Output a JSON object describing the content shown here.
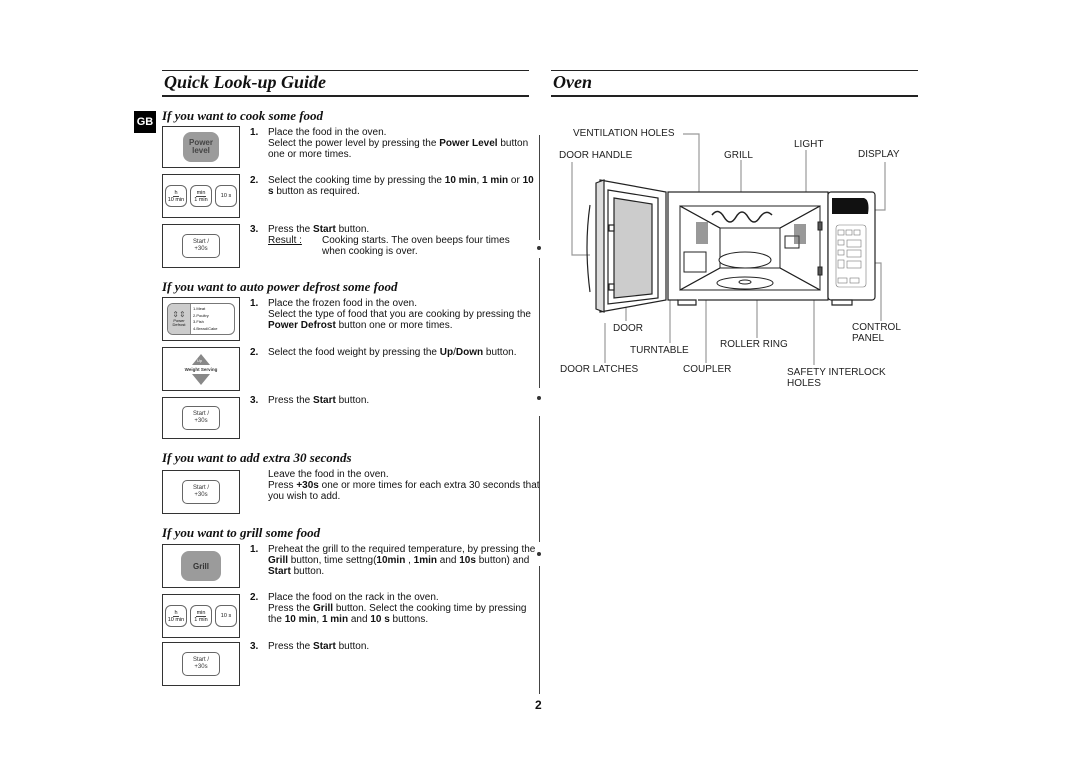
{
  "left": {
    "title": "Quick Look-up Guide",
    "lang_tab": "GB",
    "sections": [
      {
        "heading": "If you want to cook some food",
        "panels": [
          {
            "type": "power-level",
            "label_line1": "Power",
            "label_line2": "level"
          },
          {
            "type": "time-buttons",
            "buttons": [
              {
                "top": "h",
                "bottom": "10 min"
              },
              {
                "top": "min",
                "bottom": "1 min"
              },
              {
                "single": "10 s"
              }
            ]
          },
          {
            "type": "start",
            "line1": "Start /",
            "line2": "+30s"
          }
        ],
        "steps": [
          {
            "num": "1.",
            "parts": [
              "Place the food in the oven.",
              "Select the power level by pressing the ",
              "Power Level",
              " button one or more times."
            ]
          },
          {
            "num": "2.",
            "parts": [
              "Select the cooking time by pressing the ",
              "10 min",
              ", ",
              "1 min",
              " or ",
              "10 s",
              " button as required."
            ]
          },
          {
            "num": "3.",
            "parts": [
              "Press the ",
              "Start",
              " button."
            ],
            "result_label": "Result :",
            "result_text": "Cooking starts. The oven beeps four times when cooking is over."
          }
        ]
      },
      {
        "heading": "If you want to auto power defrost some food",
        "panels": [
          {
            "type": "defrost",
            "arrows": "⇕⇕",
            "label_line1": "Power",
            "label_line2": "Defrost",
            "options": [
              "1.Meat",
              "2.Poultry",
              "3.Fish",
              "4.Bread/Cake"
            ]
          },
          {
            "type": "up-down",
            "up": "Up",
            "middle": "Weight Serving",
            "down": "Down"
          },
          {
            "type": "start",
            "line1": "Start /",
            "line2": "+30s"
          }
        ],
        "steps": [
          {
            "num": "1.",
            "parts": [
              "Place the frozen food in the oven.",
              "Select the type of food that you are cooking by pressing the ",
              "Power Defrost",
              " button one or more times."
            ]
          },
          {
            "num": "2.",
            "parts": [
              "Select the food weight by pressing the ",
              "Up",
              "/",
              "Down",
              " button."
            ]
          },
          {
            "num": "3.",
            "parts": [
              "Press the ",
              "Start",
              " button."
            ]
          }
        ]
      },
      {
        "heading": "If you want to add extra 30 seconds",
        "panels": [
          {
            "type": "start",
            "line1": "Start /",
            "line2": "+30s"
          }
        ],
        "steps": [
          {
            "num": "",
            "parts": [
              "Leave the food in the oven.",
              "Press ",
              "+30s",
              " one or more times for each extra 30 seconds that you wish to add."
            ]
          }
        ]
      },
      {
        "heading": "If you want to grill some food",
        "panels": [
          {
            "type": "grill",
            "label": "Grill"
          },
          {
            "type": "time-buttons",
            "buttons": [
              {
                "top": "h",
                "bottom": "10 min"
              },
              {
                "top": "min",
                "bottom": "1 min"
              },
              {
                "single": "10 s"
              }
            ]
          },
          {
            "type": "start",
            "line1": "Start /",
            "line2": "+30s"
          }
        ],
        "steps": [
          {
            "num": "1.",
            "parts": [
              "Preheat the grill to the required temperature, by pressing the ",
              "Grill",
              " button, time settng(",
              "10min",
              " , ",
              "1min",
              " and ",
              "10s",
              " button) and ",
              "Start",
              " button."
            ]
          },
          {
            "num": "2.",
            "parts": [
              "Place the food on the rack in the oven.",
              "Press the ",
              "Grill",
              " button. Select the cooking time by pressing the ",
              "10 min",
              ", ",
              "1 min",
              " and ",
              "10 s",
              " buttons."
            ]
          },
          {
            "num": "3.",
            "parts": [
              "Press the ",
              "Start",
              " button."
            ]
          }
        ]
      }
    ]
  },
  "right": {
    "title": "Oven",
    "labels": {
      "ventilation_holes": "VENTILATION HOLES",
      "door_handle": "DOOR HANDLE",
      "grill": "GRILL",
      "light": "LIGHT",
      "display": "DISPLAY",
      "door": "DOOR",
      "turntable": "TURNTABLE",
      "roller_ring": "ROLLER RING",
      "control_panel_1": "CONTROL",
      "control_panel_2": "PANEL",
      "door_latches": "DOOR LATCHES",
      "coupler": "COUPLER",
      "safety_interlock_1": "SAFETY INTERLOCK",
      "safety_interlock_2": "HOLES"
    }
  },
  "page_number": "2"
}
